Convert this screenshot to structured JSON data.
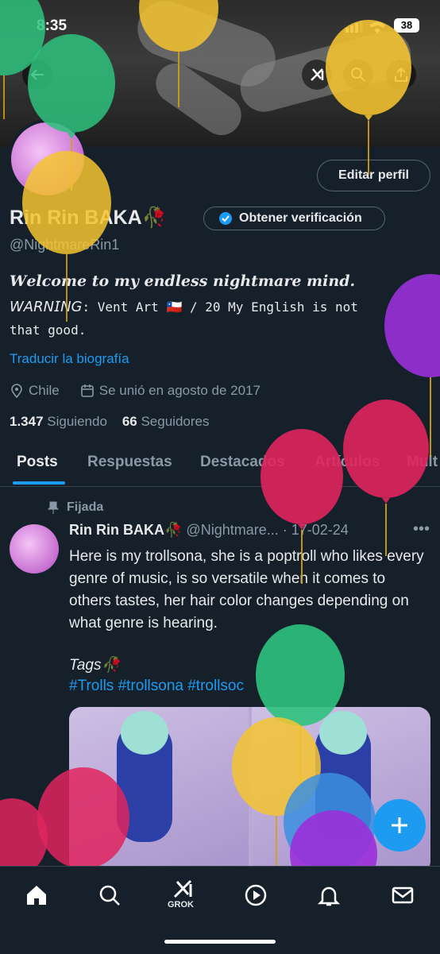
{
  "status_bar": {
    "time": "8:35",
    "battery": "38"
  },
  "profile": {
    "edit_label": "Editar perfil",
    "name": "Rin Rin BAKA🥀",
    "verify_label": "Obtener verificación",
    "handle": "@NightmareRin1",
    "bio_line1": "𝑾𝒆𝒍𝒄𝒐𝒎𝒆 𝒕𝒐 𝒎𝒚 𝒆𝒏𝒅𝒍𝒆𝒔𝒔 𝒏𝒊𝒈𝒉𝒕𝒎𝒂𝒓𝒆 𝒎𝒊𝒏𝒅.",
    "bio_warning": "𝘞𝘈𝘙𝘕𝘐𝘕𝘎",
    "bio_vent": ": 𝚅𝚎𝚗𝚝 𝙰𝚛𝚝 🇨🇱 / 20 My English is not that good.",
    "translate": "Traducir la biografía",
    "location": "Chile",
    "joined": "Se unió en agosto de 2017",
    "following_count": "1.347",
    "following_label": "Siguiendo",
    "followers_count": "66",
    "followers_label": "Seguidores"
  },
  "tabs": [
    "Posts",
    "Respuestas",
    "Destacados",
    "Artículos",
    "Mult"
  ],
  "tweet": {
    "pinned_label": "Fijada",
    "name": "Rin Rin BAKA🥀",
    "handle_date": "@Nightmare... · 17-02-24",
    "text": "Here is my trollsona, she is a poptroll who likes every genre of music, is so versatile when it comes to others tastes, her hair color changes depending on what genre is hearing.",
    "tags_label": "Tags🥀",
    "hashtags": "#Trolls #trollsona #trollsoc"
  },
  "nav": {
    "grok_label": "GROK"
  },
  "colors": {
    "accent": "#1d9bf0",
    "background": "#15202b",
    "muted": "#8b98a5"
  }
}
